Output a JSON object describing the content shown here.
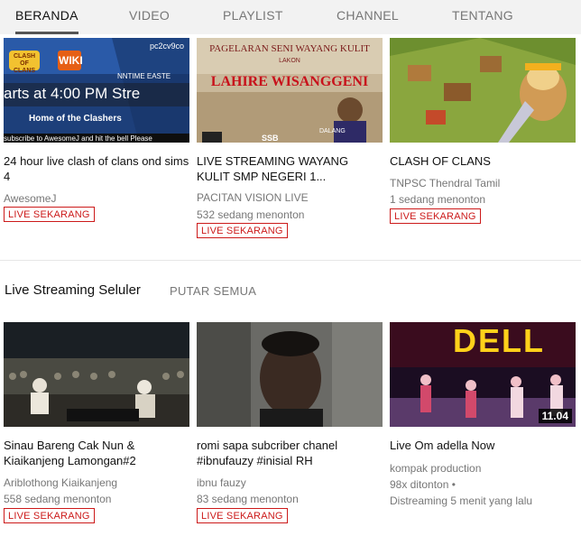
{
  "tabs": [
    {
      "label": "BERANDA",
      "active": true
    },
    {
      "label": "VIDEO"
    },
    {
      "label": "PLAYLIST"
    },
    {
      "label": "CHANNEL"
    },
    {
      "label": "TENTANG"
    }
  ],
  "row1": [
    {
      "title": "24 hour live clash of clans ond sims 4",
      "channel": "AwesomeJ",
      "live_label": "LIVE SEKARANG",
      "thumb_text": {
        "top_right": "pc2cv9co",
        "logo": "CLASH OF CLANS",
        "wiki": "WIKI",
        "runtime": "NNTIME EASTE",
        "banner": "arts at 4:00 PM Stre",
        "home": "Home of the Clashers",
        "footer": "subscribe to AwesomeJ and hit the bell Please"
      }
    },
    {
      "title": "LIVE STREAMING WAYANG KULIT SMP NEGERI 1...",
      "channel": "PACITAN VISION LIVE",
      "viewers": "532 sedang menonton",
      "live_label": "LIVE SEKARANG",
      "thumb_text": {
        "heading": "PAGELARAN SENI WAYANG KULIT",
        "lakon": "LAKON",
        "main": "LAHIRE WISANGGENI",
        "badge": "SSB",
        "dalang": "DALANG"
      }
    },
    {
      "title": "CLASH OF CLANS",
      "channel": "TNPSC Thendral Tamil",
      "viewers": "1 sedang menonton",
      "live_label": "LIVE SEKARANG"
    }
  ],
  "section": {
    "title": "Live Streaming Seluler",
    "play_all": "PUTAR SEMUA"
  },
  "row2": [
    {
      "title": "Sinau Bareng Cak Nun & Kiaikanjeng Lamongan#2",
      "channel": "Ariblothong Kiaikanjeng",
      "viewers": "558 sedang menonton",
      "live_label": "LIVE SEKARANG"
    },
    {
      "title": "romi sapa subcriber chanel #ibnufauzy #inisial RH",
      "channel": "ibnu fauzy",
      "viewers": "83 sedang menonton",
      "live_label": "LIVE SEKARANG"
    },
    {
      "title": "Live Om adella Now",
      "channel": "kompak production",
      "views": "98x ditonton",
      "streamed": "Distreaming 5 menit yang lalu",
      "duration": "11.04",
      "thumb_text": {
        "sign": "DELL"
      }
    }
  ],
  "colors": {
    "live": "#cc1a1a",
    "tab_bg": "#f2f2f2",
    "muted": "#777777"
  }
}
